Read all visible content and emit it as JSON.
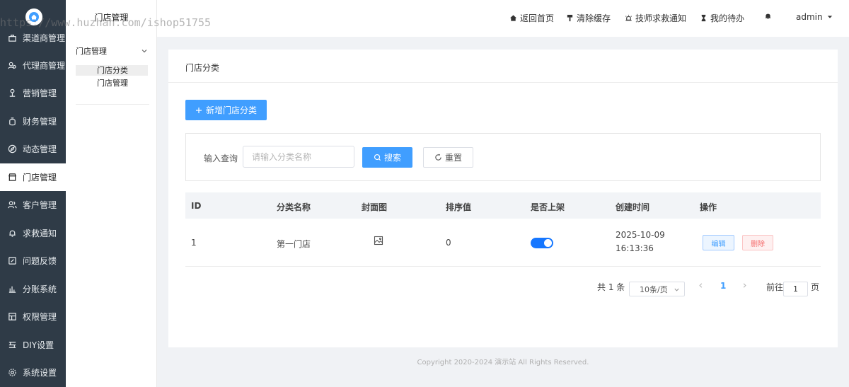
{
  "watermark": "https://www.huzhan.com/ishop51755",
  "sidebar": {
    "items": [
      {
        "label": "渠道商管理",
        "icon": "channel-icon"
      },
      {
        "label": "代理商管理",
        "icon": "agent-icon"
      },
      {
        "label": "营销管理",
        "icon": "marketing-icon"
      },
      {
        "label": "财务管理",
        "icon": "finance-icon"
      },
      {
        "label": "动态管理",
        "icon": "compass-icon"
      },
      {
        "label": "门店管理",
        "icon": "store-icon"
      },
      {
        "label": "客户管理",
        "icon": "customers-icon"
      },
      {
        "label": "求救通知",
        "icon": "bell-icon"
      },
      {
        "label": "问题反馈",
        "icon": "feedback-icon"
      },
      {
        "label": "分账系统",
        "icon": "chart-icon"
      },
      {
        "label": "权限管理",
        "icon": "permission-icon"
      },
      {
        "label": "DIY设置",
        "icon": "diy-icon"
      },
      {
        "label": "系统设置",
        "icon": "gear-icon"
      }
    ]
  },
  "subnav": {
    "title": "门店管理",
    "group": "门店管理",
    "items": [
      "门店分类",
      "门店管理"
    ]
  },
  "header": {
    "home": "返回首页",
    "clear_cache": "清除缓存",
    "rescue": "技师求救通知",
    "todo": "我的待办",
    "user": "admin"
  },
  "page": {
    "title": "门店分类",
    "add_button": "新增门店分类",
    "search_label": "输入查询",
    "search_placeholder": "请输入分类名称",
    "search_button": "搜索",
    "reset_button": "重置"
  },
  "table": {
    "columns": [
      "ID",
      "分类名称",
      "封面图",
      "排序值",
      "是否上架",
      "创建时间",
      "操作"
    ],
    "rows": [
      {
        "id": "1",
        "name": "第一门店",
        "sort": "0",
        "on_shelf": true,
        "date": "2025-10-09",
        "time": "16:13:36",
        "edit": "编辑",
        "delete": "删除"
      }
    ]
  },
  "pagination": {
    "total": "共 1 条",
    "page_size": "10条/页",
    "current": "1",
    "goto_label": "前往",
    "goto_value": "1",
    "page_suffix": "页"
  },
  "footer": "Copyright 2020-2024 演示站 All Rights Reserved.",
  "colors": {
    "primary": "#409eff",
    "sidebar": "#2f3b47",
    "danger": "#f56c6c"
  }
}
